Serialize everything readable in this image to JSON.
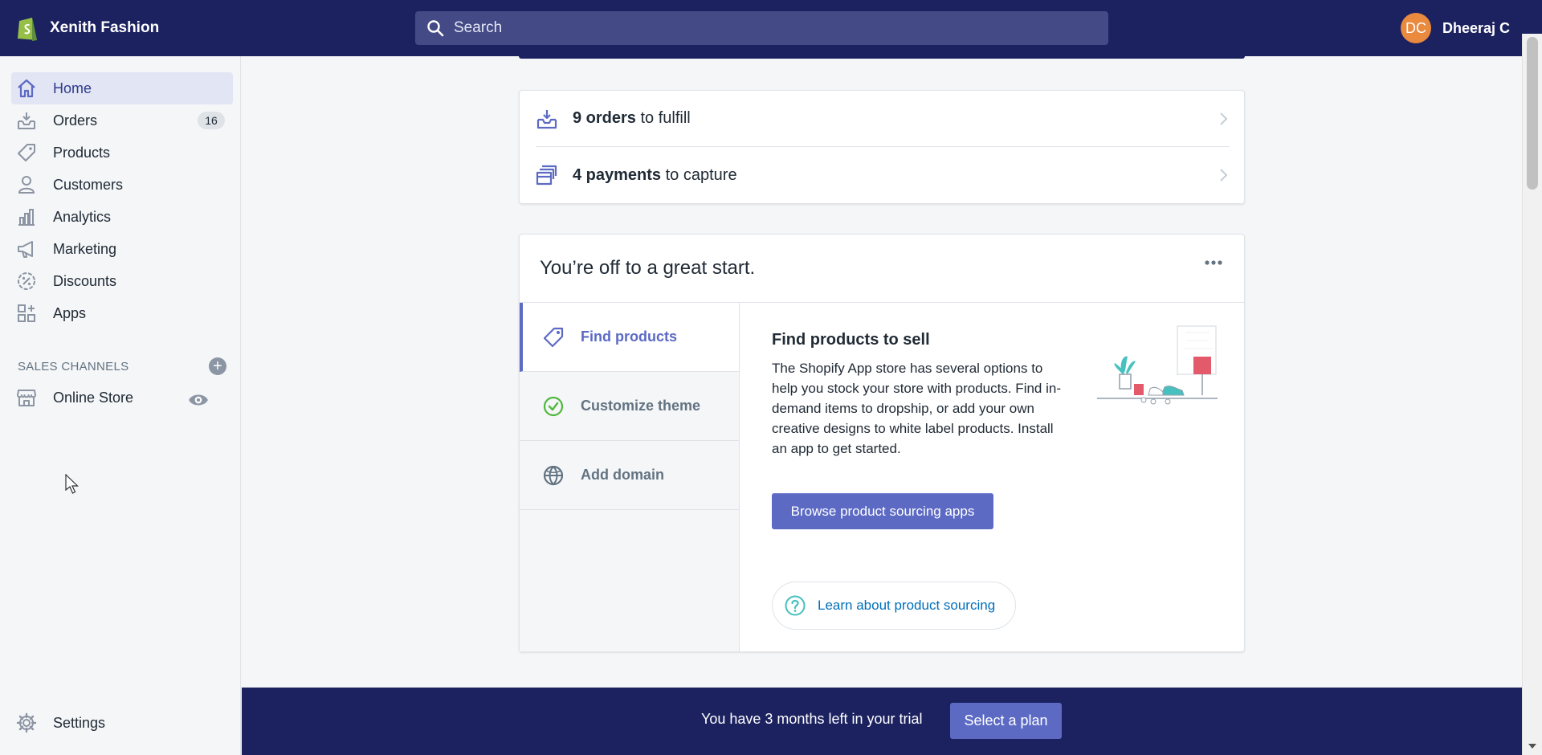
{
  "topbar": {
    "store_name": "Xenith Fashion",
    "search_placeholder": "Search",
    "user_initials": "DC",
    "user_name": "Dheeraj C"
  },
  "sidebar": {
    "items": [
      {
        "label": "Home",
        "icon": "home-icon",
        "active": true
      },
      {
        "label": "Orders",
        "icon": "orders-icon",
        "badge": "16"
      },
      {
        "label": "Products",
        "icon": "tag-icon"
      },
      {
        "label": "Customers",
        "icon": "person-icon"
      },
      {
        "label": "Analytics",
        "icon": "bar-chart-icon"
      },
      {
        "label": "Marketing",
        "icon": "megaphone-icon"
      },
      {
        "label": "Discounts",
        "icon": "discount-icon"
      },
      {
        "label": "Apps",
        "icon": "apps-icon"
      }
    ],
    "sales_channels_label": "SALES CHANNELS",
    "online_store_label": "Online Store",
    "settings_label": "Settings"
  },
  "tasks": [
    {
      "count": "9 orders",
      "rest": " to fulfill"
    },
    {
      "count": "4 payments",
      "rest": " to capture"
    }
  ],
  "setup": {
    "title": "You’re off to a great start.",
    "tabs": [
      {
        "label": "Find products"
      },
      {
        "label": "Customize theme"
      },
      {
        "label": "Add domain"
      }
    ],
    "content_title": "Find products to sell",
    "content_body": "The Shopify App store has several options to help you stock your store with products. Find in-demand items to dropship, or add your own creative designs to white label products. Install an app to get started.",
    "primary_button": "Browse product sourcing apps",
    "learn_link": "Learn about product sourcing"
  },
  "trial": {
    "text": "You have 3 months left in your trial",
    "button": "Select a plan"
  },
  "colors": {
    "topbar": "#1c2260",
    "accent": "#5c6ac4",
    "success": "#50b83c",
    "link": "#006fbb"
  }
}
